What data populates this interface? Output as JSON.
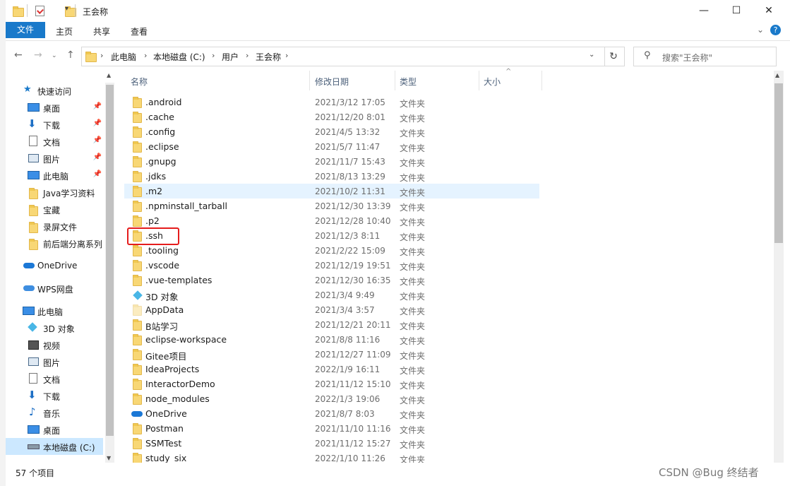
{
  "window": {
    "title": "王会称"
  },
  "title_controls": {
    "minimize": "—",
    "maximize": "☐",
    "close": "✕"
  },
  "ribbon": {
    "tabs": [
      "文件",
      "主页",
      "共享",
      "查看"
    ],
    "expand_icon": "chevron-down-icon",
    "help_icon": "help-icon"
  },
  "address": {
    "crumbs": [
      "此电脑",
      "本地磁盘 (C:)",
      "用户",
      "王会称"
    ]
  },
  "search": {
    "placeholder": "搜索\"王会称\""
  },
  "nav": {
    "quick_access": "快速访问",
    "quick_items": [
      {
        "label": "桌面",
        "icon": "desktop-icon",
        "pinned": true
      },
      {
        "label": "下载",
        "icon": "download-icon",
        "pinned": true
      },
      {
        "label": "文档",
        "icon": "document-icon",
        "pinned": true
      },
      {
        "label": "图片",
        "icon": "picture-icon",
        "pinned": true
      },
      {
        "label": "此电脑",
        "icon": "computer-icon",
        "pinned": true
      },
      {
        "label": "Java学习资料",
        "icon": "folder-icon",
        "pinned": false
      },
      {
        "label": "宝藏",
        "icon": "folder-icon",
        "pinned": false
      },
      {
        "label": "录屏文件",
        "icon": "folder-icon",
        "pinned": false
      },
      {
        "label": "前后端分离系列",
        "icon": "folder-check-icon",
        "pinned": false
      }
    ],
    "onedrive": "OneDrive",
    "wps": "WPS网盘",
    "this_pc": "此电脑",
    "pc_items": [
      {
        "label": "3D 对象",
        "icon": "cube-icon"
      },
      {
        "label": "视频",
        "icon": "video-icon"
      },
      {
        "label": "图片",
        "icon": "picture-icon"
      },
      {
        "label": "文档",
        "icon": "document-icon"
      },
      {
        "label": "下载",
        "icon": "download-icon"
      },
      {
        "label": "音乐",
        "icon": "music-icon"
      },
      {
        "label": "桌面",
        "icon": "desktop-icon"
      },
      {
        "label": "本地磁盘 (C:)",
        "icon": "drive-icon"
      }
    ]
  },
  "columns": {
    "name": "名称",
    "date": "修改日期",
    "type": "类型",
    "size": "大小"
  },
  "files": [
    {
      "name": ".android",
      "date": "2021/3/12 17:05",
      "type": "文件夹",
      "icon": "folder-icon"
    },
    {
      "name": ".cache",
      "date": "2021/12/20 8:01",
      "type": "文件夹",
      "icon": "folder-icon"
    },
    {
      "name": ".config",
      "date": "2021/4/5 13:32",
      "type": "文件夹",
      "icon": "folder-icon"
    },
    {
      "name": ".eclipse",
      "date": "2021/5/7 11:47",
      "type": "文件夹",
      "icon": "folder-icon"
    },
    {
      "name": ".gnupg",
      "date": "2021/11/7 15:43",
      "type": "文件夹",
      "icon": "folder-icon"
    },
    {
      "name": ".jdks",
      "date": "2021/8/13 13:29",
      "type": "文件夹",
      "icon": "folder-icon"
    },
    {
      "name": ".m2",
      "date": "2021/10/2 11:31",
      "type": "文件夹",
      "icon": "folder-icon"
    },
    {
      "name": ".npminstall_tarball",
      "date": "2021/12/30 13:39",
      "type": "文件夹",
      "icon": "folder-icon"
    },
    {
      "name": ".p2",
      "date": "2021/12/28 10:40",
      "type": "文件夹",
      "icon": "folder-icon"
    },
    {
      "name": ".ssh",
      "date": "2021/12/3 8:11",
      "type": "文件夹",
      "icon": "folder-icon"
    },
    {
      "name": ".tooling",
      "date": "2021/2/22 15:09",
      "type": "文件夹",
      "icon": "folder-icon"
    },
    {
      "name": ".vscode",
      "date": "2021/12/19 19:51",
      "type": "文件夹",
      "icon": "folder-icon"
    },
    {
      "name": ".vue-templates",
      "date": "2021/12/30 16:35",
      "type": "文件夹",
      "icon": "folder-icon"
    },
    {
      "name": "3D 对象",
      "date": "2021/3/4 9:49",
      "type": "文件夹",
      "icon": "cube-icon"
    },
    {
      "name": "AppData",
      "date": "2021/3/4 3:57",
      "type": "文件夹",
      "icon": "folder-hidden-icon"
    },
    {
      "name": "B站学习",
      "date": "2021/12/21 20:11",
      "type": "文件夹",
      "icon": "folder-icon"
    },
    {
      "name": "eclipse-workspace",
      "date": "2021/8/8 11:16",
      "type": "文件夹",
      "icon": "folder-icon"
    },
    {
      "name": "Gitee项目",
      "date": "2021/12/27 11:09",
      "type": "文件夹",
      "icon": "folder-icon"
    },
    {
      "name": "IdeaProjects",
      "date": "2022/1/9 16:11",
      "type": "文件夹",
      "icon": "folder-icon"
    },
    {
      "name": "InteractorDemo",
      "date": "2021/11/12 15:10",
      "type": "文件夹",
      "icon": "folder-icon"
    },
    {
      "name": "node_modules",
      "date": "2022/1/3 19:06",
      "type": "文件夹",
      "icon": "folder-icon"
    },
    {
      "name": "OneDrive",
      "date": "2021/8/7 8:03",
      "type": "文件夹",
      "icon": "cloud-icon"
    },
    {
      "name": "Postman",
      "date": "2021/11/10 11:16",
      "type": "文件夹",
      "icon": "folder-icon"
    },
    {
      "name": "SSMTest",
      "date": "2021/11/12 15:27",
      "type": "文件夹",
      "icon": "folder-icon"
    },
    {
      "name": "study_six",
      "date": "2022/1/10 11:26",
      "type": "文件夹",
      "icon": "folder-icon"
    }
  ],
  "selected_row": ".m2",
  "highlighted_row": ".ssh",
  "status": {
    "count": "57 个项目"
  },
  "watermark": "CSDN @Bug 终结者",
  "colors": {
    "accent": "#1979ca",
    "selection": "#e5f3ff",
    "highlight": "#e51c1c",
    "folder": "#f8d775"
  }
}
